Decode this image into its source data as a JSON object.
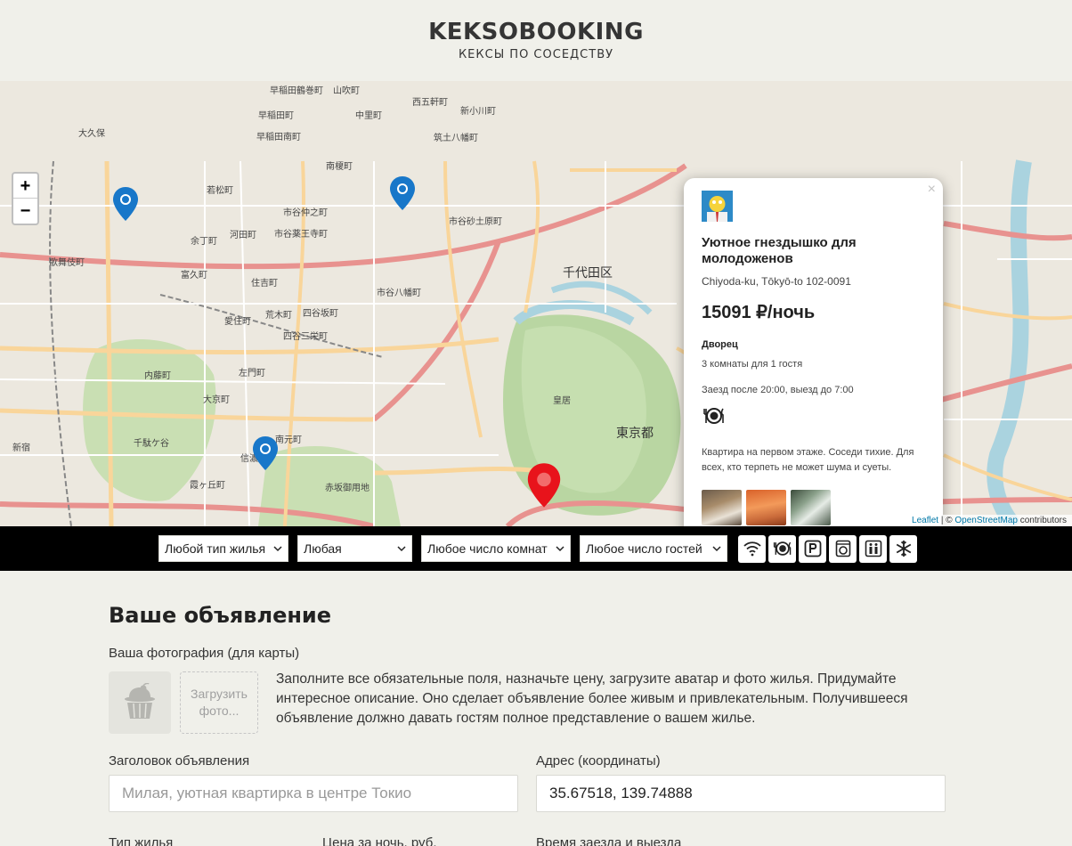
{
  "header": {
    "title": "KEKSOBOOKING",
    "subtitle": "КЕКСЫ ПО СОСЕДСТВУ"
  },
  "map": {
    "zoom_in": "+",
    "zoom_out": "−",
    "labels": [
      {
        "text": "早稲田鶴巻町",
        "cls": ""
      },
      {
        "text": "山吹町",
        "cls": ""
      },
      {
        "text": "西五軒町",
        "cls": ""
      },
      {
        "text": "新小川町",
        "cls": ""
      },
      {
        "text": "早稲田町",
        "cls": ""
      },
      {
        "text": "中里町",
        "cls": ""
      },
      {
        "text": "大久保",
        "cls": ""
      },
      {
        "text": "早稲田南町",
        "cls": ""
      },
      {
        "text": "筑土八幡町",
        "cls": ""
      },
      {
        "text": "南榎町",
        "cls": ""
      },
      {
        "text": "若松町",
        "cls": ""
      },
      {
        "text": "市谷仲之町",
        "cls": ""
      },
      {
        "text": "市谷砂土原町",
        "cls": ""
      },
      {
        "text": "余丁町",
        "cls": ""
      },
      {
        "text": "河田町",
        "cls": ""
      },
      {
        "text": "市谷薬王寺町",
        "cls": ""
      },
      {
        "text": "千代田区",
        "cls": "big"
      },
      {
        "text": "歌舞伎町",
        "cls": ""
      },
      {
        "text": "富久町",
        "cls": ""
      },
      {
        "text": "住吉町",
        "cls": ""
      },
      {
        "text": "市谷八幡町",
        "cls": ""
      },
      {
        "text": "四谷坂町",
        "cls": ""
      },
      {
        "text": "荒木町",
        "cls": ""
      },
      {
        "text": "愛住町",
        "cls": ""
      },
      {
        "text": "四谷三栄町",
        "cls": ""
      },
      {
        "text": "内藤町",
        "cls": ""
      },
      {
        "text": "左門町",
        "cls": ""
      },
      {
        "text": "大京町",
        "cls": ""
      },
      {
        "text": "皇居",
        "cls": ""
      },
      {
        "text": "東京都",
        "cls": "big"
      },
      {
        "text": "信濃町",
        "cls": ""
      },
      {
        "text": "霞ヶ丘町",
        "cls": ""
      },
      {
        "text": "南元町",
        "cls": ""
      },
      {
        "text": "赤坂御用地",
        "cls": ""
      },
      {
        "text": "新宿",
        "cls": ""
      },
      {
        "text": "千駄ケ谷",
        "cls": ""
      }
    ],
    "attribution_leaflet": "Leaflet",
    "attribution_sep": " | © ",
    "attribution_osm": "OpenStreetMap",
    "attribution_rest": " contributors"
  },
  "popup": {
    "close": "×",
    "title": "Уютное гнездышко для молодоженов",
    "address": "Chiyoda-ku, Tōkyō-to 102-0091",
    "price": "15091 ₽/ночь",
    "type": "Дворец",
    "capacity": "3 комнаты для 1 гостя",
    "time": "Заезд после 20:00, выезд до 7:00",
    "feature_icon": "dishwasher-icon",
    "description": "Квартира на первом этаже. Соседи тихие. Для всех, кто терпеть не может шума и суеты."
  },
  "filters": {
    "housing_type": "Любой тип жилья",
    "price": "Любая",
    "rooms": "Любое число комнат",
    "guests": "Любое число гостей",
    "features": [
      "wifi-icon",
      "dishwasher-icon",
      "parking-icon",
      "washer-icon",
      "elevator-icon",
      "conditioner-icon"
    ]
  },
  "form": {
    "title": "Ваше объявление",
    "avatar_label": "Ваша фотография (для карты)",
    "upload_label": "Загрузить фото...",
    "note": "Заполните все обязательные поля, назначьте цену, загрузите аватар и фото жилья. Придумайте интересное описание. Оно сделает объявление более живым и привлекательным. Получившееся объявление должно давать гостям полное представление о вашем жилье.",
    "title_label": "Заголовок объявления",
    "title_placeholder": "Милая, уютная квартирка в центре Токио",
    "address_label": "Адрес (координаты)",
    "address_value": "35.67518, 139.74888",
    "type_label": "Тип жилья",
    "price_label": "Цена за ночь, руб.",
    "time_label": "Время заезда и выезда"
  }
}
